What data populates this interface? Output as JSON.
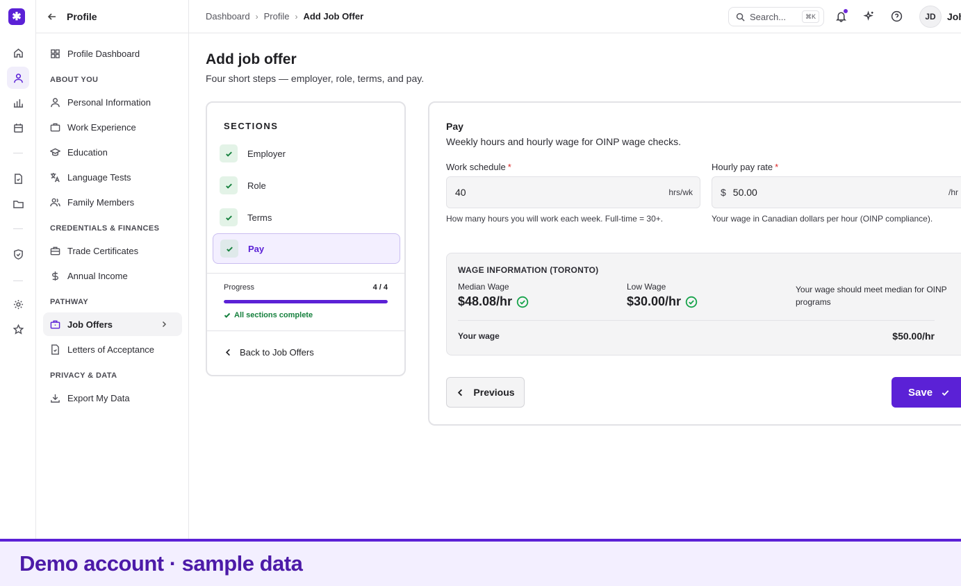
{
  "app": {
    "logo_glyph": "✱",
    "accent": "#5b21d6"
  },
  "sidebar": {
    "title": "Profile",
    "dashboard_label": "Profile Dashboard",
    "sections": {
      "about": "ABOUT YOU",
      "credentials": "CREDENTIALS & FINANCES",
      "pathway": "PATHWAY",
      "privacy": "PRIVACY & DATA"
    },
    "items": {
      "personal": "Personal Information",
      "work": "Work Experience",
      "education": "Education",
      "language": "Language Tests",
      "family": "Family Members",
      "trade": "Trade Certificates",
      "income": "Annual Income",
      "job_offers": "Job Offers",
      "letters": "Letters of Acceptance",
      "export": "Export My Data"
    }
  },
  "topbar": {
    "breadcrumb": [
      "Dashboard",
      "Profile",
      "Add Job Offer"
    ],
    "search_placeholder": "Search...",
    "search_shortcut": "⌘K",
    "avatar_initials": "JD",
    "user_name": "John"
  },
  "page": {
    "title": "Add job offer",
    "subtitle": "Four short steps — employer, role, terms, and pay."
  },
  "sections_panel": {
    "title": "SECTIONS",
    "steps": [
      "Employer",
      "Role",
      "Terms",
      "Pay"
    ],
    "active_step": "Pay",
    "progress_label": "Progress",
    "progress_count": "4 / 4",
    "progress_fraction": 1.0,
    "complete_text": "All sections complete",
    "back_link": "Back to Job Offers"
  },
  "form": {
    "section_title": "Pay",
    "section_subtitle": "Weekly hours and hourly wage for OINP wage checks.",
    "work_schedule": {
      "label": "Work schedule",
      "required_mark": "*",
      "value": "40",
      "suffix": "hrs/wk",
      "help": "How many hours you will work each week. Full-time = 30+."
    },
    "hourly_rate": {
      "label": "Hourly pay rate",
      "required_mark": "*",
      "prefix": "$",
      "value": "50.00",
      "suffix": "/hr",
      "help": "Your wage in Canadian dollars per hour (OINP compliance)."
    },
    "wage_info": {
      "title": "WAGE INFORMATION (TORONTO)",
      "median_label": "Median Wage",
      "median_value": "$48.08/hr",
      "low_label": "Low Wage",
      "low_value": "$30.00/hr",
      "note": "Your wage should meet median for OINP programs",
      "your_wage_label": "Your wage",
      "your_wage_value": "$50.00/hr"
    },
    "previous_label": "Previous",
    "save_label": "Save"
  },
  "banner": {
    "text": "Demo account · sample data"
  }
}
